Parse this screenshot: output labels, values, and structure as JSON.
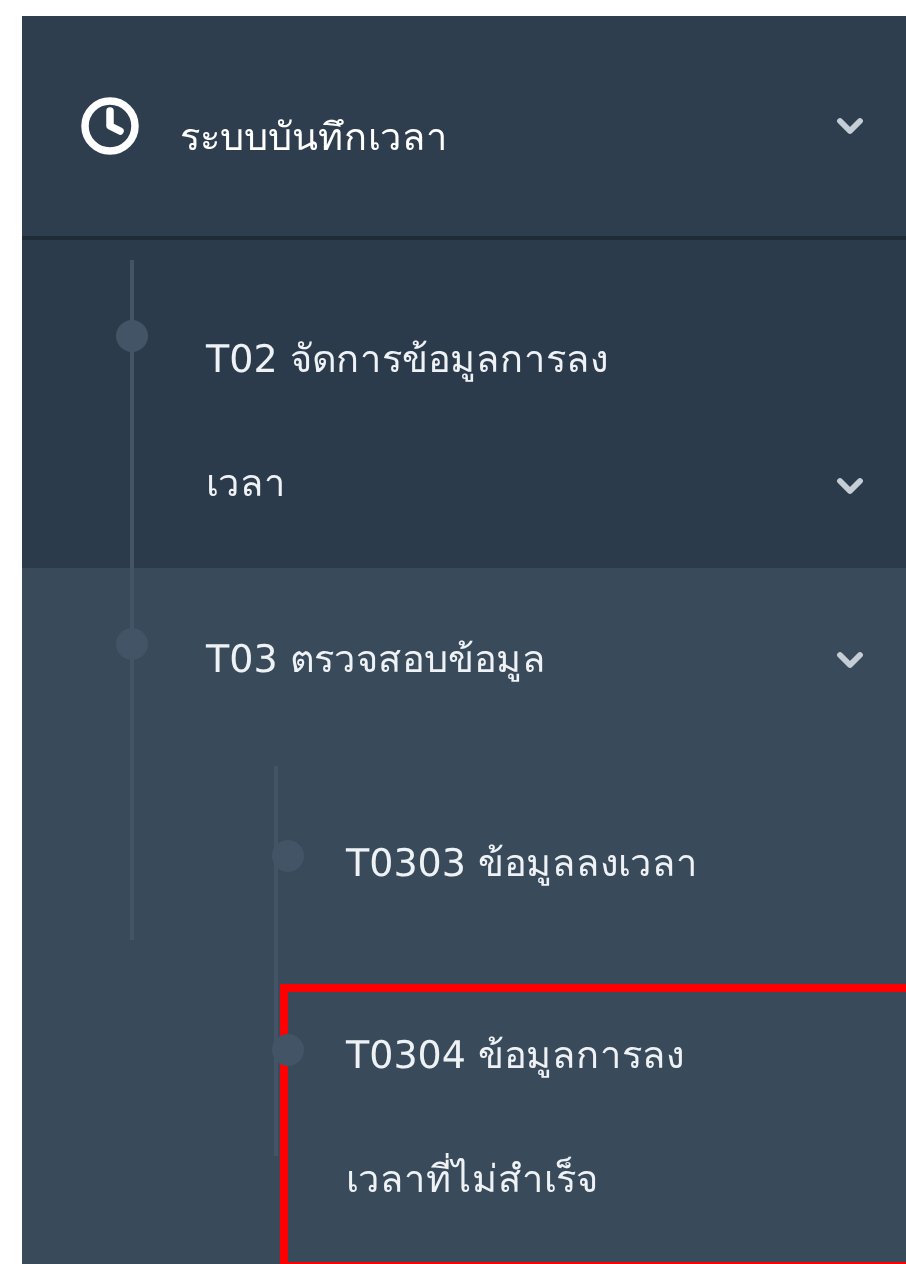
{
  "menu": {
    "label": "ระบบบันทึกเวลา",
    "kind": "group",
    "children": [
      {
        "lines": [
          "T02 จัดการข้อมูลการลง",
          "เวลา"
        ],
        "kind": "group",
        "selected": false
      },
      {
        "lines": [
          "T03 ตรวจสอบข้อมูล"
        ],
        "kind": "group",
        "selected": true,
        "children": [
          {
            "lines": [
              "T0303 ข้อมูลลงเวลา"
            ],
            "highlighted": false
          },
          {
            "lines": [
              "T0304 ข้อมูลการลง",
              "เวลาที่ไม่สำเร็จ"
            ],
            "highlighted": true
          }
        ]
      }
    ]
  }
}
